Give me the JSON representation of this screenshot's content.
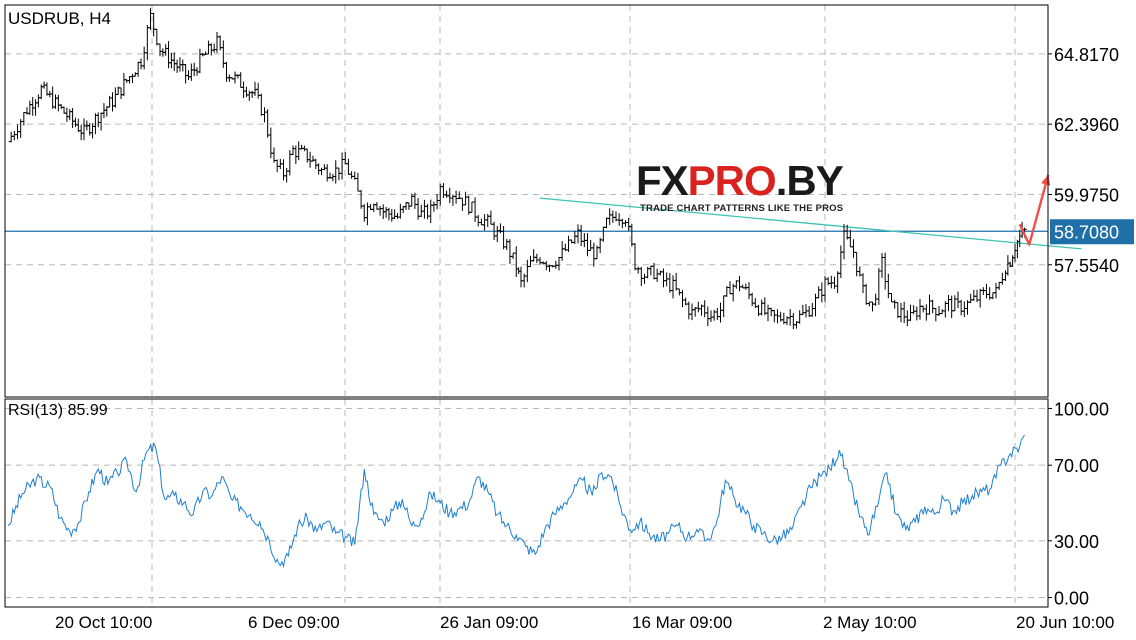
{
  "symbol_label": "USDRUB, H4",
  "rsi_label": "RSI(13) 85.99",
  "logo": {
    "text_dark": "FX",
    "text_red": "PRO",
    "text_suffix": ".BY",
    "tagline": "TRADE CHART PATTERNS LIKE THE PROS"
  },
  "colors": {
    "candles": "#000000",
    "hline": "#1f6fa8",
    "trendline": "#3cc4b4",
    "arrow": "#f0504a",
    "rsi_line": "#1f7fd0",
    "price_tag_bg": "#1f6fa8",
    "grid": "#b8b8b8"
  },
  "chart_data": [
    {
      "type": "candlestick",
      "title": "USDRUB, H4",
      "price_axis_ticks": [
        "64.8170",
        "62.3960",
        "59.9750",
        "57.5540"
      ],
      "current_price_label": "58.7080",
      "ylim": [
        53.0,
        66.5
      ],
      "time_axis_labels": [
        "20 Oct 10:00",
        "6 Dec 09:00",
        "26 Jan 09:00",
        "16 Mar 09:00",
        "2 May 10:00",
        "20 Jun 10:00"
      ],
      "series": [
        {
          "name": "USDRUB, H4",
          "points": [
            {
              "x": 0,
              "y": 61.8
            },
            {
              "x": 4,
              "y": 62.9
            },
            {
              "x": 7,
              "y": 63.6
            },
            {
              "x": 10,
              "y": 63.1
            },
            {
              "x": 13,
              "y": 62.6
            },
            {
              "x": 16,
              "y": 62.1
            },
            {
              "x": 19,
              "y": 62.7
            },
            {
              "x": 22,
              "y": 63.2
            },
            {
              "x": 25,
              "y": 63.9
            },
            {
              "x": 28,
              "y": 64.6
            },
            {
              "x": 30,
              "y": 66.1
            },
            {
              "x": 32,
              "y": 65.0
            },
            {
              "x": 35,
              "y": 64.5
            },
            {
              "x": 38,
              "y": 64.0
            },
            {
              "x": 41,
              "y": 64.7
            },
            {
              "x": 44,
              "y": 65.2
            },
            {
              "x": 46,
              "y": 64.2
            },
            {
              "x": 49,
              "y": 63.8
            },
            {
              "x": 52,
              "y": 63.4
            },
            {
              "x": 54,
              "y": 62.7
            },
            {
              "x": 56,
              "y": 61.0
            },
            {
              "x": 58,
              "y": 60.7
            },
            {
              "x": 60,
              "y": 61.5
            },
            {
              "x": 63,
              "y": 61.3
            },
            {
              "x": 66,
              "y": 60.8
            },
            {
              "x": 69,
              "y": 60.8
            },
            {
              "x": 71,
              "y": 61.0
            },
            {
              "x": 73,
              "y": 60.3
            },
            {
              "x": 75,
              "y": 59.4
            },
            {
              "x": 77,
              "y": 59.8
            },
            {
              "x": 79,
              "y": 59.4
            },
            {
              "x": 82,
              "y": 59.2
            },
            {
              "x": 85,
              "y": 59.8
            },
            {
              "x": 87,
              "y": 59.3
            },
            {
              "x": 89,
              "y": 59.4
            },
            {
              "x": 91,
              "y": 60.2
            },
            {
              "x": 93,
              "y": 60.1
            },
            {
              "x": 95,
              "y": 59.9
            },
            {
              "x": 97,
              "y": 59.6
            },
            {
              "x": 99,
              "y": 59.2
            },
            {
              "x": 101,
              "y": 59.0
            },
            {
              "x": 103,
              "y": 58.6
            },
            {
              "x": 105,
              "y": 58.2
            },
            {
              "x": 107,
              "y": 57.5
            },
            {
              "x": 108,
              "y": 56.9
            },
            {
              "x": 110,
              "y": 57.6
            },
            {
              "x": 112,
              "y": 57.8
            },
            {
              "x": 114,
              "y": 57.6
            },
            {
              "x": 116,
              "y": 57.8
            },
            {
              "x": 118,
              "y": 58.2
            },
            {
              "x": 120,
              "y": 58.6
            },
            {
              "x": 122,
              "y": 58.1
            },
            {
              "x": 124,
              "y": 57.9
            },
            {
              "x": 126,
              "y": 59.0
            },
            {
              "x": 128,
              "y": 59.3
            },
            {
              "x": 130,
              "y": 59.2
            },
            {
              "x": 132,
              "y": 57.6
            },
            {
              "x": 134,
              "y": 57.2
            },
            {
              "x": 136,
              "y": 57.3
            },
            {
              "x": 138,
              "y": 57.0
            },
            {
              "x": 140,
              "y": 56.8
            },
            {
              "x": 142,
              "y": 56.3
            },
            {
              "x": 144,
              "y": 55.9
            },
            {
              "x": 146,
              "y": 56.1
            },
            {
              "x": 148,
              "y": 55.8
            },
            {
              "x": 150,
              "y": 56.0
            },
            {
              "x": 152,
              "y": 56.8
            },
            {
              "x": 154,
              "y": 56.9
            },
            {
              "x": 156,
              "y": 56.5
            },
            {
              "x": 158,
              "y": 56.1
            },
            {
              "x": 160,
              "y": 55.8
            },
            {
              "x": 162,
              "y": 55.7
            },
            {
              "x": 164,
              "y": 55.8
            },
            {
              "x": 166,
              "y": 55.7
            },
            {
              "x": 168,
              "y": 55.9
            },
            {
              "x": 170,
              "y": 56.3
            },
            {
              "x": 172,
              "y": 56.9
            },
            {
              "x": 174,
              "y": 57.0
            },
            {
              "x": 176,
              "y": 58.5
            },
            {
              "x": 178,
              "y": 58.0
            },
            {
              "x": 180,
              "y": 56.6
            },
            {
              "x": 182,
              "y": 56.1
            },
            {
              "x": 184,
              "y": 57.6
            },
            {
              "x": 186,
              "y": 56.1
            },
            {
              "x": 188,
              "y": 55.9
            },
            {
              "x": 190,
              "y": 55.7
            },
            {
              "x": 192,
              "y": 56.1
            },
            {
              "x": 194,
              "y": 56.1
            },
            {
              "x": 196,
              "y": 56.0
            },
            {
              "x": 198,
              "y": 56.2
            },
            {
              "x": 200,
              "y": 56.1
            },
            {
              "x": 202,
              "y": 56.2
            },
            {
              "x": 204,
              "y": 56.4
            },
            {
              "x": 206,
              "y": 56.6
            },
            {
              "x": 208,
              "y": 56.6
            },
            {
              "x": 210,
              "y": 57.5
            },
            {
              "x": 211,
              "y": 57.7
            },
            {
              "x": 212,
              "y": 58.2
            },
            {
              "x": 213,
              "y": 58.5
            },
            {
              "x": 214,
              "y": 58.7
            }
          ]
        }
      ],
      "horizontal_line": 58.708,
      "trendline": {
        "from": {
          "x": 112,
          "y": 59.85
        },
        "to": {
          "x": 226,
          "y": 58.1
        }
      },
      "forecast_arrow": [
        {
          "x": 213,
          "y": 58.95
        },
        {
          "x": 215,
          "y": 58.25
        },
        {
          "x": 219,
          "y": 60.65
        }
      ]
    },
    {
      "type": "line",
      "title": "RSI(13) 85.99",
      "ylim": [
        -5,
        105
      ],
      "y_axis_ticks": [
        "100.00",
        "70.00",
        "30.00",
        "0.00"
      ],
      "series": [
        {
          "name": "RSI(13)",
          "points": [
            {
              "x": 0,
              "y": 38
            },
            {
              "x": 3,
              "y": 55
            },
            {
              "x": 6,
              "y": 63
            },
            {
              "x": 9,
              "y": 58
            },
            {
              "x": 11,
              "y": 42
            },
            {
              "x": 13,
              "y": 35
            },
            {
              "x": 15,
              "y": 40
            },
            {
              "x": 17,
              "y": 56
            },
            {
              "x": 19,
              "y": 68
            },
            {
              "x": 21,
              "y": 60
            },
            {
              "x": 23,
              "y": 66
            },
            {
              "x": 25,
              "y": 72
            },
            {
              "x": 27,
              "y": 56
            },
            {
              "x": 29,
              "y": 76
            },
            {
              "x": 31,
              "y": 80
            },
            {
              "x": 33,
              "y": 52
            },
            {
              "x": 35,
              "y": 54
            },
            {
              "x": 37,
              "y": 50
            },
            {
              "x": 39,
              "y": 44
            },
            {
              "x": 41,
              "y": 56
            },
            {
              "x": 43,
              "y": 54
            },
            {
              "x": 45,
              "y": 64
            },
            {
              "x": 47,
              "y": 52
            },
            {
              "x": 49,
              "y": 48
            },
            {
              "x": 51,
              "y": 44
            },
            {
              "x": 53,
              "y": 40
            },
            {
              "x": 55,
              "y": 30
            },
            {
              "x": 57,
              "y": 18
            },
            {
              "x": 59,
              "y": 22
            },
            {
              "x": 61,
              "y": 38
            },
            {
              "x": 63,
              "y": 42
            },
            {
              "x": 65,
              "y": 35
            },
            {
              "x": 67,
              "y": 40
            },
            {
              "x": 69,
              "y": 34
            },
            {
              "x": 71,
              "y": 32
            },
            {
              "x": 73,
              "y": 28
            },
            {
              "x": 75,
              "y": 68
            },
            {
              "x": 77,
              "y": 44
            },
            {
              "x": 79,
              "y": 40
            },
            {
              "x": 81,
              "y": 46
            },
            {
              "x": 83,
              "y": 52
            },
            {
              "x": 85,
              "y": 38
            },
            {
              "x": 87,
              "y": 42
            },
            {
              "x": 89,
              "y": 55
            },
            {
              "x": 91,
              "y": 50
            },
            {
              "x": 93,
              "y": 45
            },
            {
              "x": 95,
              "y": 47
            },
            {
              "x": 97,
              "y": 50
            },
            {
              "x": 99,
              "y": 64
            },
            {
              "x": 101,
              "y": 56
            },
            {
              "x": 103,
              "y": 44
            },
            {
              "x": 105,
              "y": 38
            },
            {
              "x": 107,
              "y": 33
            },
            {
              "x": 109,
              "y": 27
            },
            {
              "x": 111,
              "y": 23
            },
            {
              "x": 113,
              "y": 36
            },
            {
              "x": 115,
              "y": 44
            },
            {
              "x": 117,
              "y": 50
            },
            {
              "x": 119,
              "y": 56
            },
            {
              "x": 121,
              "y": 62
            },
            {
              "x": 123,
              "y": 54
            },
            {
              "x": 125,
              "y": 66
            },
            {
              "x": 127,
              "y": 64
            },
            {
              "x": 129,
              "y": 48
            },
            {
              "x": 131,
              "y": 36
            },
            {
              "x": 133,
              "y": 40
            },
            {
              "x": 135,
              "y": 34
            },
            {
              "x": 137,
              "y": 30
            },
            {
              "x": 139,
              "y": 34
            },
            {
              "x": 141,
              "y": 38
            },
            {
              "x": 143,
              "y": 32
            },
            {
              "x": 145,
              "y": 36
            },
            {
              "x": 147,
              "y": 30
            },
            {
              "x": 149,
              "y": 38
            },
            {
              "x": 151,
              "y": 62
            },
            {
              "x": 153,
              "y": 52
            },
            {
              "x": 155,
              "y": 46
            },
            {
              "x": 157,
              "y": 38
            },
            {
              "x": 159,
              "y": 34
            },
            {
              "x": 161,
              "y": 30
            },
            {
              "x": 163,
              "y": 32
            },
            {
              "x": 165,
              "y": 36
            },
            {
              "x": 167,
              "y": 48
            },
            {
              "x": 169,
              "y": 58
            },
            {
              "x": 171,
              "y": 64
            },
            {
              "x": 173,
              "y": 68
            },
            {
              "x": 175,
              "y": 78
            },
            {
              "x": 177,
              "y": 62
            },
            {
              "x": 179,
              "y": 46
            },
            {
              "x": 181,
              "y": 33
            },
            {
              "x": 183,
              "y": 48
            },
            {
              "x": 185,
              "y": 66
            },
            {
              "x": 187,
              "y": 44
            },
            {
              "x": 189,
              "y": 36
            },
            {
              "x": 191,
              "y": 40
            },
            {
              "x": 193,
              "y": 48
            },
            {
              "x": 195,
              "y": 44
            },
            {
              "x": 197,
              "y": 52
            },
            {
              "x": 199,
              "y": 46
            },
            {
              "x": 201,
              "y": 50
            },
            {
              "x": 203,
              "y": 54
            },
            {
              "x": 205,
              "y": 56
            },
            {
              "x": 207,
              "y": 58
            },
            {
              "x": 209,
              "y": 70
            },
            {
              "x": 211,
              "y": 76
            },
            {
              "x": 213,
              "y": 80
            },
            {
              "x": 214,
              "y": 86
            }
          ]
        }
      ]
    }
  ]
}
